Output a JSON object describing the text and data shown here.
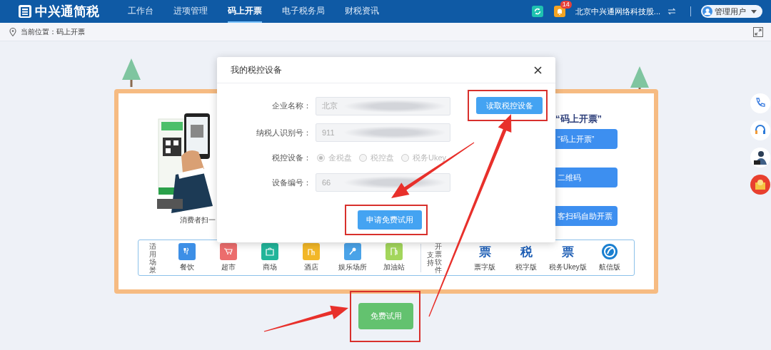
{
  "header": {
    "logo_text": "中兴通简税",
    "nav": [
      {
        "label": "工作台",
        "selected": false
      },
      {
        "label": "进项管理",
        "selected": false
      },
      {
        "label": "码上开票",
        "selected": true
      },
      {
        "label": "电子税务局",
        "selected": false
      },
      {
        "label": "财税资讯",
        "selected": false
      }
    ],
    "badge_count": "14",
    "company": "北京中兴通网络科技股...",
    "user": "管理用户"
  },
  "breadcrumb": "当前位置：码上开票",
  "card": {
    "caption": "消费者扫一",
    "right_title": "“码上开票”",
    "right_buttons": [
      "“码上开票”",
      "二维码",
      "客扫码自助开票"
    ],
    "scenes_label": "适用场景",
    "scenes": [
      {
        "label": "餐饮",
        "color": "#3d8fe6"
      },
      {
        "label": "超市",
        "color": "#ec6d6d"
      },
      {
        "label": "商场",
        "color": "#22b59a"
      },
      {
        "label": "酒店",
        "color": "#f2b728"
      },
      {
        "label": "娱乐场所",
        "color": "#4aa3e8"
      },
      {
        "label": "加油站",
        "color": "#a3d65c"
      }
    ],
    "software_label": [
      "支持",
      "开票软件"
    ],
    "software": [
      {
        "label": "票字版",
        "kind": "glyph",
        "glyph": "票"
      },
      {
        "label": "税字版",
        "kind": "glyph",
        "glyph": "税"
      },
      {
        "label": "税务Ukey版",
        "kind": "glyph",
        "glyph": "票"
      },
      {
        "label": "航信版",
        "kind": "circle"
      }
    ]
  },
  "trial_button": "免费试用",
  "dialog": {
    "title": "我的税控设备",
    "fields": [
      {
        "kind": "input",
        "label": "企业名称：",
        "value": "北京"
      },
      {
        "kind": "input",
        "label": "纳税人识别号：",
        "value": "911"
      },
      {
        "kind": "radio",
        "label": "税控设备：",
        "options": [
          {
            "label": "金税盘",
            "selected": true
          },
          {
            "label": "税控盘",
            "selected": false
          },
          {
            "label": "税务Ukey",
            "selected": false
          }
        ]
      },
      {
        "kind": "input",
        "label": "设备编号：",
        "value": "66"
      }
    ],
    "read_button": "读取税控设备",
    "apply_button": "申请免费试用"
  }
}
